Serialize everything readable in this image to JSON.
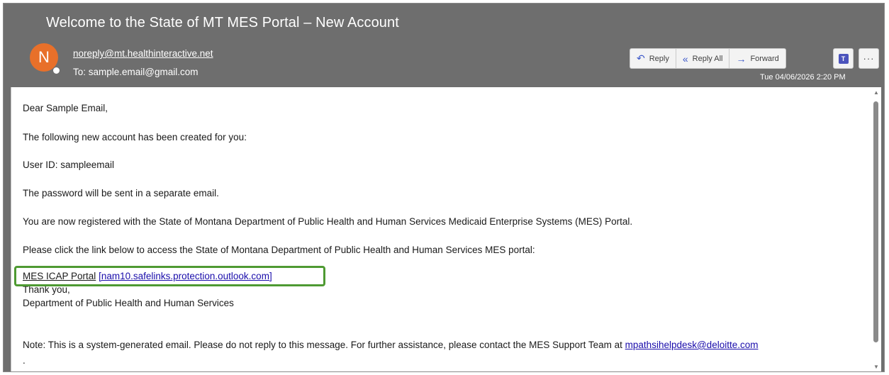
{
  "email": {
    "subject": "Welcome to the State of MT MES Portal – New Account",
    "avatar_initial": "N",
    "sender": "noreply@mt.healthinteractive.net",
    "to": "To: sample.email@gmail.com",
    "date": "Tue 04/06/2026 2:20 PM"
  },
  "actions": {
    "reply": "Reply",
    "reply_all": "Reply All",
    "forward": "Forward",
    "more": "···"
  },
  "body": {
    "greeting": "Dear Sample Email,",
    "line1": "The following new account has been created for you:",
    "user_id": "User ID: sampleemail",
    "password_note": "The password will be sent in a separate email.",
    "registered": "You are now registered with the State of Montana Department of Public Health and Human Services Medicaid Enterprise Systems (MES) Portal.",
    "click_link": "Please click the link below to access the State of Montana Department of Public Health and Human Services MES portal:",
    "portal_link_text": "MES ICAP Portal",
    "portal_link_url": "[nam10.safelinks.protection.outlook.com]",
    "thanks": "Thank you,",
    "department": "Department of Public Health and Human Services",
    "note_prefix": "Note: This is a system-generated email. Please do not reply to this message. For further assistance, please contact the MES Support Team at ",
    "helpdesk_email": "mpathsihelpdesk@deloitte.com",
    "trailing": "."
  },
  "colors": {
    "header_bg": "#6e6e6e",
    "avatar": "#e8702a",
    "highlight_box": "#4e9a32",
    "link": "#1a0dab"
  }
}
